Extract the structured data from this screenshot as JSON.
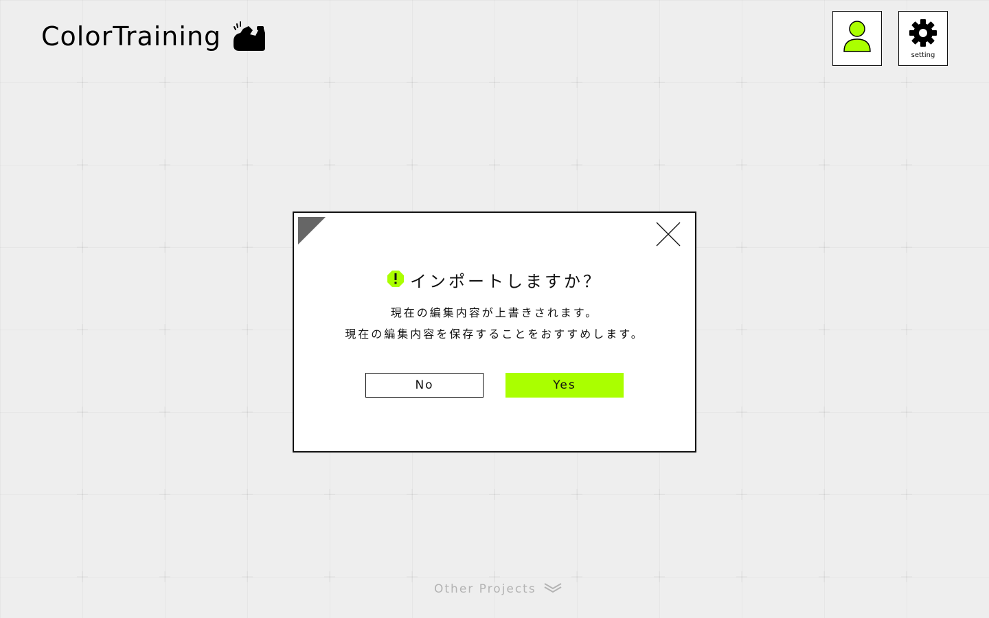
{
  "app": {
    "title": "ColorTraining"
  },
  "header": {
    "user_icon": "user-icon",
    "setting_label": "setting",
    "setting_icon": "gear-icon"
  },
  "dialog": {
    "title": "インポートしますか？",
    "message_line1": "現在の編集内容が上書きされます。",
    "message_line2": "現在の編集内容を保存することをおすすめします。",
    "no_label": "No",
    "yes_label": "Yes",
    "warning_icon": "warning-icon",
    "close_icon": "close-icon"
  },
  "footer": {
    "other_projects_label": "Other Projects",
    "chevron_icon": "double-chevron-down-icon"
  },
  "colors": {
    "accent": "#aaff00",
    "background": "#eeeeee",
    "text": "#111111",
    "muted": "#b3b3b3",
    "corner": "#666666"
  }
}
